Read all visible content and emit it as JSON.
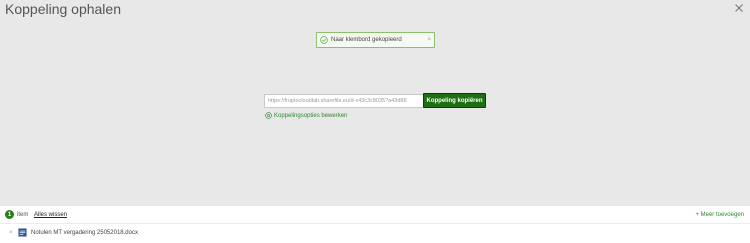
{
  "dialog": {
    "title": "Koppeling ophalen",
    "close_icon": "close-icon"
  },
  "toast": {
    "message": "Naar klembord gekopieerd",
    "icon": "check-circle-icon",
    "dismiss": "×"
  },
  "link": {
    "value": "https://fruptocloudlab.sharefile.eu/d-s43c3c8035?a43d88",
    "copy_label": "Koppeling kopiëren",
    "options_label": "Koppelingsopties bewerken",
    "options_icon": "gear-circle-icon"
  },
  "footer": {
    "count": "1",
    "count_label": "item",
    "clear_label": "Alles wissen",
    "add_label": "+ Meer toevoegen",
    "files": [
      {
        "name": "Notulen MT vergadering 25052018.docx",
        "remove": "×",
        "icon": "word-document-icon"
      }
    ]
  },
  "colors": {
    "accent": "#1e6f14",
    "link_green": "#2e8a2e",
    "toast_border": "#8bc06a",
    "background": "#e8e8e8"
  }
}
